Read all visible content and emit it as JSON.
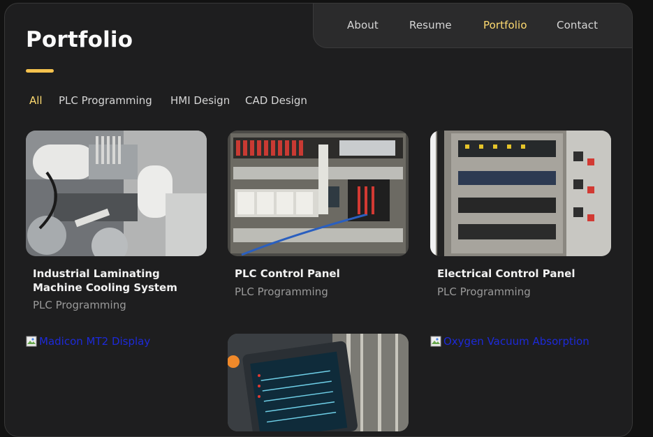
{
  "nav": {
    "items": [
      {
        "label": "About",
        "active": false
      },
      {
        "label": "Resume",
        "active": false
      },
      {
        "label": "Portfolio",
        "active": true
      },
      {
        "label": "Contact",
        "active": false
      }
    ]
  },
  "page": {
    "title": "Portfolio"
  },
  "filters": [
    {
      "label": "All",
      "active": true
    },
    {
      "label": "PLC Programming",
      "active": false
    },
    {
      "label": "HMI Design",
      "active": false
    },
    {
      "label": "CAD Design",
      "active": false
    }
  ],
  "projects": [
    {
      "title": "Industrial Laminating Machine Cooling System",
      "category": "PLC Programming",
      "image": "laminating-machine-photo"
    },
    {
      "title": "PLC Control Panel",
      "category": "PLC Programming",
      "image": "plc-panel-photo"
    },
    {
      "title": "Electrical Control Panel",
      "category": "PLC Programming",
      "image": "electrical-panel-photo"
    },
    {
      "alt": "Madicon MT2 Display",
      "image": "broken-image-icon"
    },
    {
      "image": "hmi-display-photo"
    },
    {
      "alt": "Oxygen Vacuum Absorption",
      "image": "broken-image-icon"
    }
  ],
  "colors": {
    "accent": "#ffdb70",
    "background": "#1e1e1f",
    "text": "#fafafa",
    "muted": "#9a9a9a",
    "link": "#1d2ad8"
  }
}
